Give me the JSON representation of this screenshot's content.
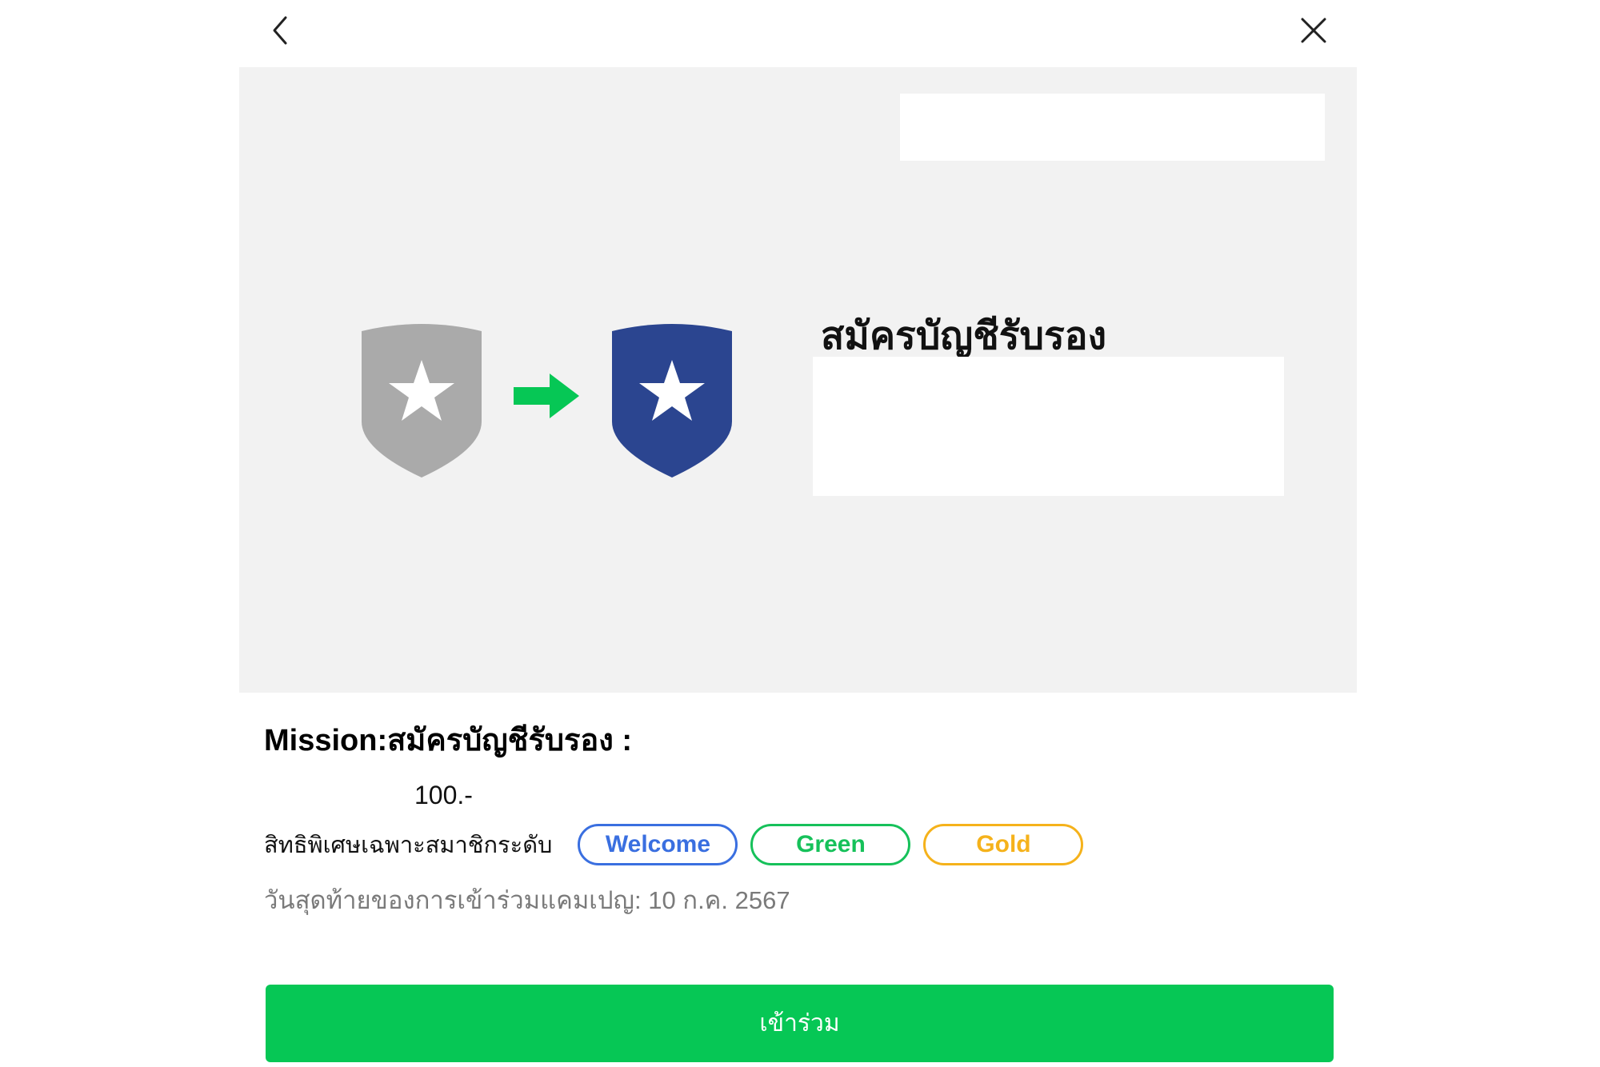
{
  "colors": {
    "accent_green": "#06c755",
    "welcome": "#3a6fe0",
    "green_tier": "#16c15a",
    "gold": "#f5b21b",
    "shield_gray": "#aaaaaa",
    "shield_blue": "#2b4590",
    "banner_bg": "#f2f2f2"
  },
  "header": {
    "back_icon": "chevron-left-icon",
    "close_icon": "close-icon"
  },
  "banner": {
    "heading": "สมัครบัญชีรับรอง",
    "icons": [
      "shield-star-gray-icon",
      "arrow-right-icon",
      "shield-star-blue-icon"
    ]
  },
  "mission": {
    "title": "Mission:สมัครบัญชีรับรอง :",
    "points": "100.-",
    "tier_label": "สิทธิพิเศษเฉพาะสมาชิกระดับ",
    "tiers": [
      "Welcome",
      "Green",
      "Gold"
    ],
    "deadline_label": "วันสุดท้ายของการเข้าร่วมแคมเปญ:",
    "deadline_value": "10 ก.ค. 2567"
  },
  "actions": {
    "join_label": "เข้าร่วม"
  }
}
